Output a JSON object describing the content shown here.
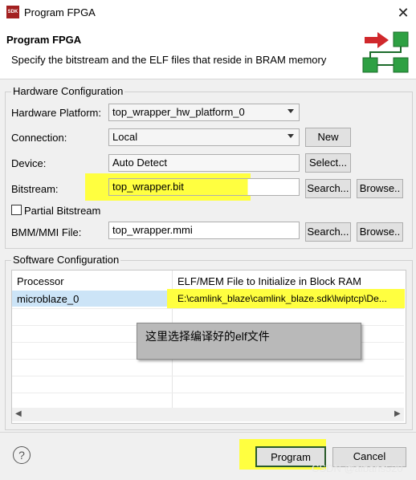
{
  "window": {
    "title": "Program FPGA",
    "icon_text": "SDK",
    "close_icon": "close-icon"
  },
  "header": {
    "title": "Program FPGA",
    "description": "Specify the bitstream and the ELF files that reside in BRAM memory"
  },
  "hardware": {
    "group_label": "Hardware Configuration",
    "platform_label": "Hardware Platform:",
    "platform_value": "top_wrapper_hw_platform_0",
    "connection_label": "Connection:",
    "connection_value": "Local",
    "new_label": "New",
    "device_label": "Device:",
    "device_value": "Auto Detect",
    "select_label": "Select...",
    "bitstream_label": "Bitstream:",
    "bitstream_value": "top_wrapper.bit",
    "search_label": "Search...",
    "browse_label": "Browse..",
    "partial_label": "Partial Bitstream",
    "partial_checked": false,
    "bmm_label": "BMM/MMI File:",
    "bmm_value": "top_wrapper.mmi"
  },
  "software": {
    "group_label": "Software Configuration",
    "columns": [
      "Processor",
      "ELF/MEM File to Initialize in Block RAM"
    ],
    "rows": [
      {
        "processor": "microblaze_0",
        "elf": "E:\\camlink_blaze\\camlink_blaze.sdk\\lwiptcp\\De..."
      }
    ]
  },
  "annotation": "这里选择编译好的elf文件",
  "footer": {
    "help_icon": "help-icon",
    "program_label": "Program",
    "cancel_label": "Cancel",
    "watermark": "CSDN @aibans520"
  },
  "colors": {
    "highlight": "#ffff40",
    "selection": "#cce4f7",
    "logo_red": "#d0282c",
    "logo_green": "#2ea043"
  }
}
